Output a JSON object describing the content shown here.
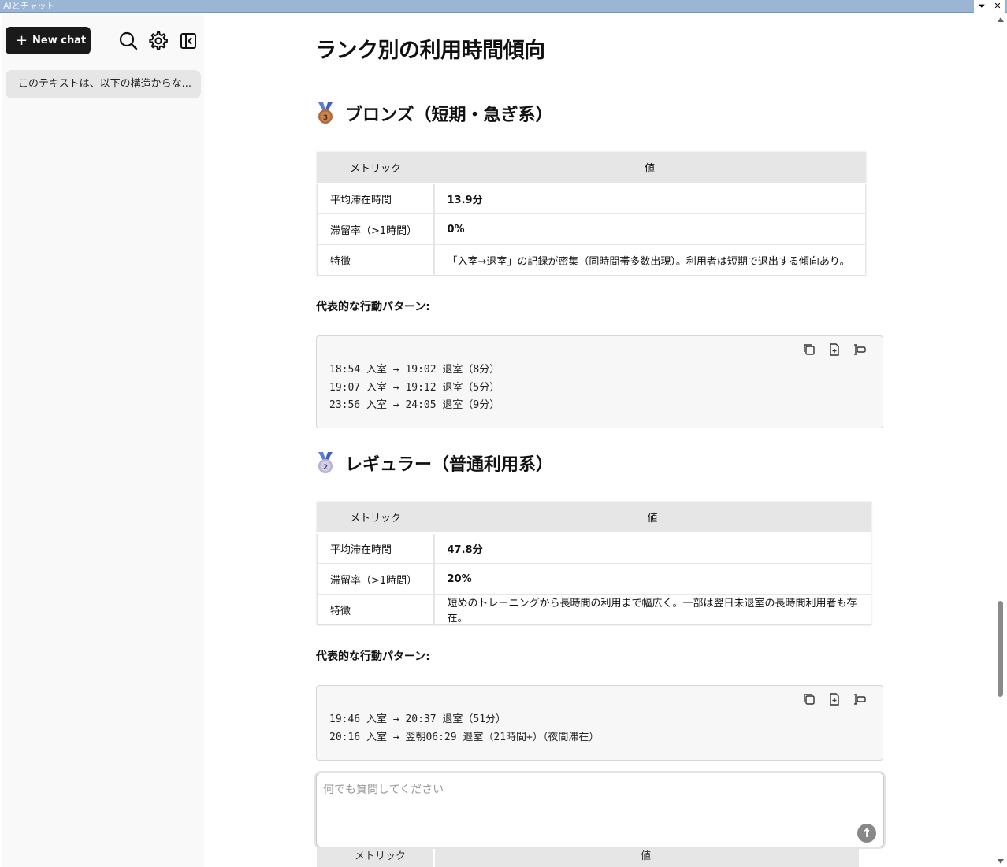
{
  "window": {
    "title": "AIとチャット",
    "dropdown_glyph": "⏷",
    "close_glyph": "✕"
  },
  "sidebar": {
    "new_chat_label": "New chat",
    "icons": [
      "search-icon",
      "gear-icon",
      "collapse-sidebar-icon"
    ],
    "history": [
      {
        "label": "このテキストは、以下の構造からな..."
      }
    ]
  },
  "content": {
    "heading": "ランク別の利用時間傾向",
    "sections": [
      {
        "medal": "bronze-medal-icon",
        "medal_number": "3",
        "title": "ブロンズ（短期・急ぎ系）",
        "table": {
          "headers": [
            "メトリック",
            "値"
          ],
          "rows": [
            [
              "平均滞在時間",
              "13.9分"
            ],
            [
              "滞留率（>1時間）",
              "0%"
            ],
            [
              "特徴",
              "「入室→退室」の記録が密集（同時間帯多数出現）。利用者は短期で退出する傾向あり。"
            ]
          ]
        },
        "pattern_label": "代表的な行動パターン:",
        "code_lines": [
          "18:54 入室 → 19:02 退室（8分）",
          "19:07 入室 → 19:12 退室（5分）",
          "23:56 入室 → 24:05 退室（9分）"
        ]
      },
      {
        "medal": "silver-medal-icon",
        "medal_number": "2",
        "title": "レギュラー（普通利用系）",
        "table": {
          "headers": [
            "メトリック",
            "値"
          ],
          "rows": [
            [
              "平均滞在時間",
              "47.8分"
            ],
            [
              "滞留率（>1時間）",
              "20%"
            ],
            [
              "特徴",
              "短めのトレーニングから長時間の利用まで幅広く。一部は翌日未退室の長時間利用者も存在。"
            ]
          ]
        },
        "pattern_label": "代表的な行動パターン:",
        "code_lines": [
          "19:46 入室 → 20:37 退室（51分）",
          "20:16 入室 → 翌朝06:29 退室（21時間+）（夜間滞在）"
        ]
      }
    ],
    "partial_table_headers": [
      "メトリック",
      "値"
    ]
  },
  "chat_input": {
    "placeholder": "何でも質問してください",
    "value": ""
  },
  "colors": {
    "sidebar_bg": "#f9f9f9",
    "new_chat_bg": "#1a1a1a",
    "table_header_bg": "#e6e6e6",
    "code_bg": "#f7f7f7"
  }
}
